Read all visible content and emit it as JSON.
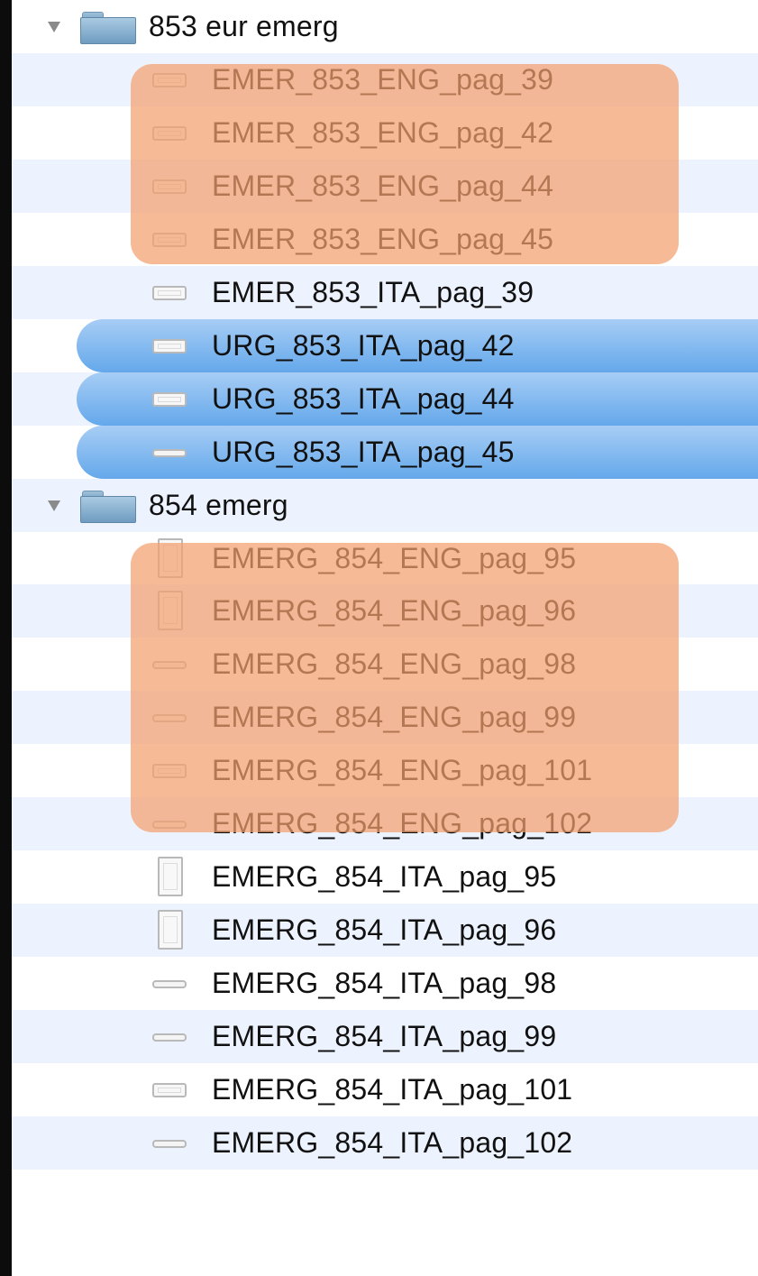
{
  "accent_colors": {
    "selection": "#64a8eb",
    "highlight": "#f4a06e",
    "alt_row": "#edf3fe"
  },
  "folders": [
    {
      "name": "853 eur emerg",
      "icon": "folder-icon",
      "expanded": true,
      "files": [
        {
          "name": "EMER_853_ENG_pag_39",
          "icon": "document-landscape-icon",
          "highlighted": true,
          "selected": false
        },
        {
          "name": "EMER_853_ENG_pag_42",
          "icon": "document-landscape-icon",
          "highlighted": true,
          "selected": false
        },
        {
          "name": "EMER_853_ENG_pag_44",
          "icon": "document-landscape-icon",
          "highlighted": true,
          "selected": false
        },
        {
          "name": "EMER_853_ENG_pag_45",
          "icon": "document-landscape-icon",
          "highlighted": true,
          "selected": false
        },
        {
          "name": "EMER_853_ITA_pag_39",
          "icon": "document-landscape-icon",
          "highlighted": false,
          "selected": false
        },
        {
          "name": "URG_853_ITA_pag_42",
          "icon": "document-landscape-icon",
          "highlighted": false,
          "selected": true
        },
        {
          "name": "URG_853_ITA_pag_44",
          "icon": "document-landscape-icon",
          "highlighted": false,
          "selected": true
        },
        {
          "name": "URG_853_ITA_pag_45",
          "icon": "document-thin-icon",
          "highlighted": false,
          "selected": true
        }
      ]
    },
    {
      "name": "854 emerg",
      "icon": "folder-icon",
      "expanded": true,
      "files": [
        {
          "name": "EMERG_854_ENG_pag_95",
          "icon": "document-portrait-icon",
          "highlighted": true,
          "selected": false
        },
        {
          "name": "EMERG_854_ENG_pag_96",
          "icon": "document-portrait-icon",
          "highlighted": true,
          "selected": false
        },
        {
          "name": "EMERG_854_ENG_pag_98",
          "icon": "document-thin-icon",
          "highlighted": true,
          "selected": false
        },
        {
          "name": "EMERG_854_ENG_pag_99",
          "icon": "document-thin-icon",
          "highlighted": true,
          "selected": false
        },
        {
          "name": "EMERG_854_ENG_pag_101",
          "icon": "document-landscape-icon",
          "highlighted": true,
          "selected": false
        },
        {
          "name": "EMERG_854_ENG_pag_102",
          "icon": "document-thin-icon",
          "highlighted": true,
          "selected": false
        },
        {
          "name": "EMERG_854_ITA_pag_95",
          "icon": "document-portrait-icon",
          "highlighted": false,
          "selected": false
        },
        {
          "name": "EMERG_854_ITA_pag_96",
          "icon": "document-portrait-icon",
          "highlighted": false,
          "selected": false
        },
        {
          "name": "EMERG_854_ITA_pag_98",
          "icon": "document-thin-icon",
          "highlighted": false,
          "selected": false
        },
        {
          "name": "EMERG_854_ITA_pag_99",
          "icon": "document-thin-icon",
          "highlighted": false,
          "selected": false
        },
        {
          "name": "EMERG_854_ITA_pag_101",
          "icon": "document-landscape-icon",
          "highlighted": false,
          "selected": false
        },
        {
          "name": "EMERG_854_ITA_pag_102",
          "icon": "document-thin-icon",
          "highlighted": false,
          "selected": false
        }
      ]
    }
  ]
}
